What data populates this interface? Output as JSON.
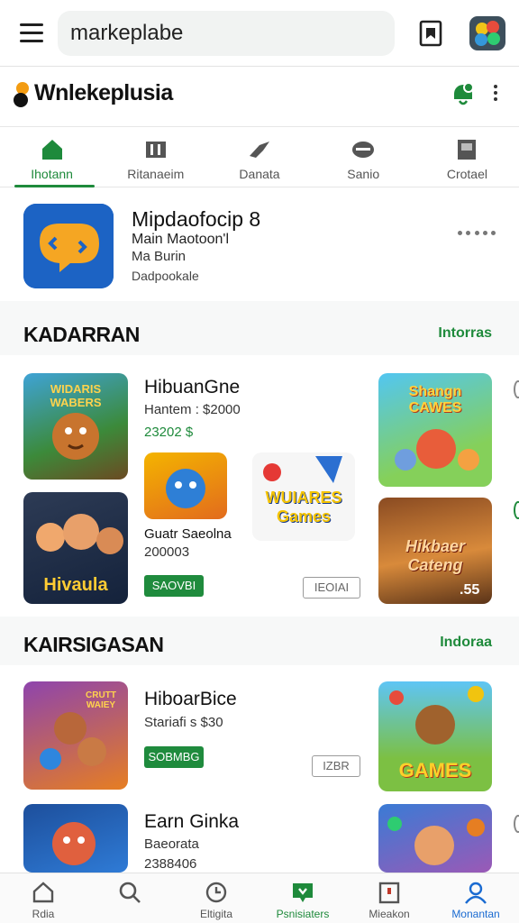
{
  "search": {
    "value": "markeplabe"
  },
  "brand": {
    "name": "Wnlekeplusia"
  },
  "tabs": [
    {
      "label": "Ihotann",
      "icon": "home-icon",
      "active": true
    },
    {
      "label": "Ritanaeim",
      "icon": "movie-icon",
      "active": false
    },
    {
      "label": "Danata",
      "icon": "bird-icon",
      "active": false
    },
    {
      "label": "Sanio",
      "icon": "controller-icon",
      "active": false
    },
    {
      "label": "Crotael",
      "icon": "book-icon",
      "active": false
    }
  ],
  "featured": {
    "title": "Mipdaofocip 8",
    "line1": "Main Maotoon'l",
    "line2": "Ma Burin",
    "line3": "Dadpookale"
  },
  "section1": {
    "title": "KADARRAN",
    "link": "Intorras",
    "game_a": {
      "title": "HibuanGne",
      "sub": "Hantem : $2000",
      "price": "23202 $"
    },
    "game_b": {
      "title": "Guatr Saeolna",
      "sub": "200003"
    },
    "tiles": {
      "t1": "WIDARIS WABERS",
      "t2": "Hivaula",
      "t3": "WUIARES Games",
      "t4": "Shangn CAWES",
      "t5": "Hikbaer Cateng",
      "t5_price": ".55"
    },
    "btn_green": "SAOVBI",
    "btn_outline": "IEOIAI"
  },
  "section2": {
    "title": "KAIRSIGASAN",
    "link": "Indoraa",
    "game_a": {
      "title": "HiboarBice",
      "sub": "Stariafi s $30",
      "button": "SOBMBG",
      "outline": "IZBR"
    },
    "game_b": {
      "title": "Earn Ginka",
      "sub": "Baeorata",
      "price": "2388406"
    },
    "tiles": {
      "t1": "CRUTT WAIEY",
      "t2": "GAMES"
    }
  },
  "bottom_nav": [
    {
      "label": "Rdia",
      "icon": "home-outline-icon"
    },
    {
      "label": "",
      "icon": "search-icon"
    },
    {
      "label": "Eltigita",
      "icon": "clock-icon"
    },
    {
      "label": "Psnisiaters",
      "icon": "chat-heart-icon"
    },
    {
      "label": "Mieakon",
      "icon": "clipboard-icon"
    },
    {
      "label": "Monantan",
      "icon": "person-icon"
    }
  ],
  "colors": {
    "accent": "#1e8a3b",
    "blue": "#1a6bd1",
    "brand_orange": "#f39c12"
  }
}
